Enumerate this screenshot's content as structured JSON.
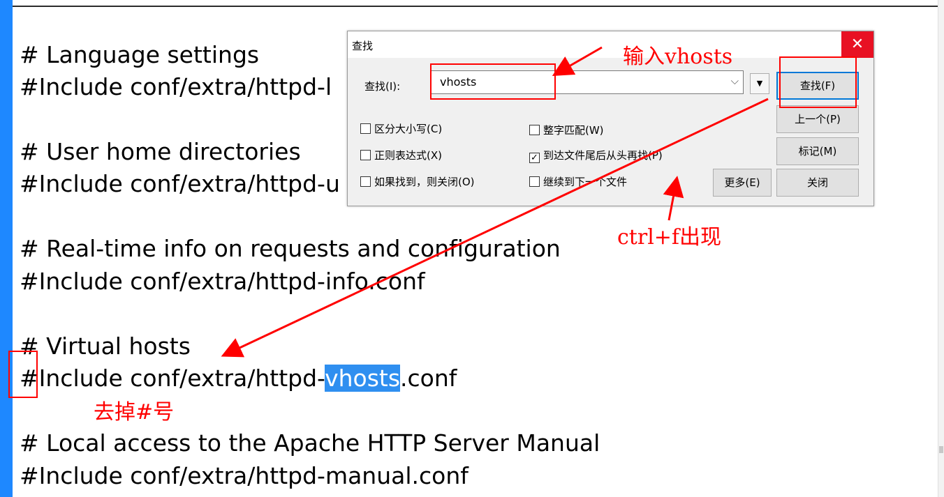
{
  "editor": {
    "lines": [
      "# Language settings",
      "#Include conf/extra/httpd-l",
      "# User home directories",
      "#Include conf/extra/httpd-u",
      "# Real-time info on requests and configuration",
      "#Include conf/extra/httpd-info.conf",
      "# Virtual hosts",
      "#Include conf/extra/httpd-",
      "vhosts",
      ".conf",
      "# Local access to the Apache HTTP Server Manual",
      "#Include conf/extra/httpd-manual.conf"
    ]
  },
  "dialog": {
    "title": "查找",
    "close_icon": "✕",
    "find_label": "查找(I):",
    "find_value": "vhosts",
    "buttons": {
      "find": "查找(F)",
      "prev": "上一个(P)",
      "mark": "标记(M)",
      "more": "更多(E)",
      "close": "关闭"
    },
    "checkboxes": [
      {
        "label": "区分大小写(C)",
        "checked": false
      },
      {
        "label": "整字匹配(W)",
        "checked": false
      },
      {
        "label": "正则表达式(X)",
        "checked": false
      },
      {
        "label": "到达文件尾后从头再找(P)",
        "checked": true
      },
      {
        "label": "如果找到，则关闭(O)",
        "checked": false
      },
      {
        "label": "继续到下一个文件",
        "checked": false
      }
    ]
  },
  "annotations": {
    "input_hint": "输入vhosts",
    "shortcut_hint": "ctrl+f出现",
    "remove_hash_hint": "去掉#号"
  },
  "colors": {
    "highlight": "#2f8ff0",
    "annotation": "#ff0000",
    "left_bar": "#1e88ff",
    "close_button": "#e81123"
  }
}
